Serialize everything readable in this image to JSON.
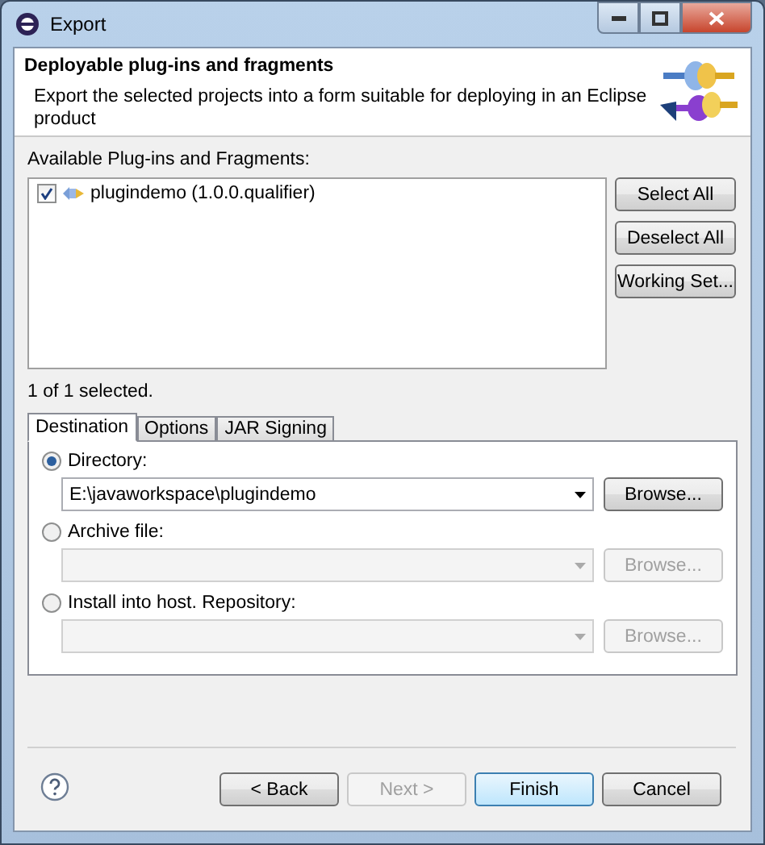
{
  "window": {
    "title": "Export"
  },
  "header": {
    "title": "Deployable plug-ins and fragments",
    "description": "Export the selected projects into a form suitable for deploying in an Eclipse product"
  },
  "plugins": {
    "label": "Available Plug-ins and Fragments:",
    "items": [
      {
        "label": "plugindemo (1.0.0.qualifier)",
        "checked": true
      }
    ],
    "buttons": [
      "Select All",
      "Deselect All",
      "Working Set..."
    ],
    "status": "1 of 1 selected."
  },
  "tabs": [
    {
      "label": "Destination",
      "selected": true
    },
    {
      "label": "Options",
      "selected": false
    },
    {
      "label": "JAR Signing",
      "selected": false
    }
  ],
  "destinations": [
    {
      "label": "Directory:",
      "selected": true,
      "value": "E:\\javaworkspace\\plugindemo",
      "browse": "Browse..."
    },
    {
      "label": "Archive file:",
      "selected": false,
      "browse": "Browse..."
    },
    {
      "label": "Install into host. Repository:",
      "selected": false,
      "browse": "Browse..."
    }
  ],
  "footer": [
    {
      "label": "< Back",
      "disabled": false,
      "default": false
    },
    {
      "label": "Next >",
      "disabled": true,
      "default": false
    },
    {
      "label": "Finish",
      "disabled": false,
      "default": true
    },
    {
      "label": "Cancel",
      "disabled": false,
      "default": false
    }
  ]
}
